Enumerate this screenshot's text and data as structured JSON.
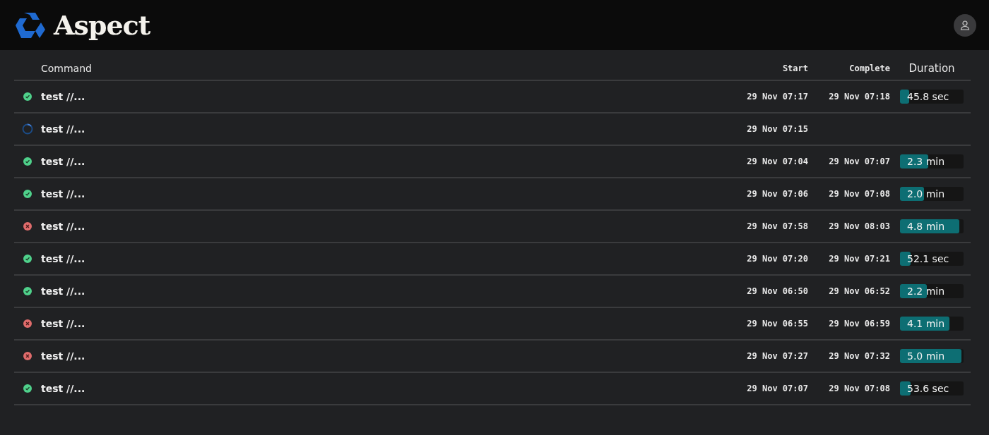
{
  "header": {
    "brand": "Aspect"
  },
  "table": {
    "columns": [
      "Command",
      "Start",
      "Complete",
      "Duration"
    ],
    "rows": [
      {
        "kind": "success",
        "command": "test //...",
        "start": "29 Nov 07:17",
        "complete": "29 Nov 07:18",
        "duration": "45.8 sec",
        "level": 0.15
      },
      {
        "kind": "running",
        "command": "test //...",
        "start": "29 Nov 07:15"
      },
      {
        "kind": "success",
        "command": "test //...",
        "start": "29 Nov 07:04",
        "complete": "29 Nov 07:07",
        "duration": "2.3 min",
        "level": 0.46
      },
      {
        "kind": "success",
        "command": "test //...",
        "start": "29 Nov 07:06",
        "complete": "29 Nov 07:08",
        "duration": "2.0 min",
        "level": 0.39
      },
      {
        "kind": "failed",
        "command": "test //...",
        "start": "29 Nov 07:58",
        "complete": "29 Nov 08:03",
        "duration": "4.8 min",
        "level": 0.97
      },
      {
        "kind": "success",
        "command": "test //...",
        "start": "29 Nov 07:20",
        "complete": "29 Nov 07:21",
        "duration": "52.1 sec",
        "level": 0.17
      },
      {
        "kind": "success",
        "command": "test //...",
        "start": "29 Nov 06:50",
        "complete": "29 Nov 06:52",
        "duration": "2.2 min",
        "level": 0.44
      },
      {
        "kind": "failed",
        "command": "test //...",
        "start": "29 Nov 06:55",
        "complete": "29 Nov 06:59",
        "duration": "4.1 min",
        "level": 0.81
      },
      {
        "kind": "failed",
        "command": "test //...",
        "start": "29 Nov 07:27",
        "complete": "29 Nov 07:32",
        "duration": "5.0 min",
        "level": 1.0
      },
      {
        "kind": "success",
        "command": "test //...",
        "start": "29 Nov 07:07",
        "complete": "29 Nov 07:08",
        "duration": "53.6 sec",
        "level": 0.17
      }
    ]
  }
}
